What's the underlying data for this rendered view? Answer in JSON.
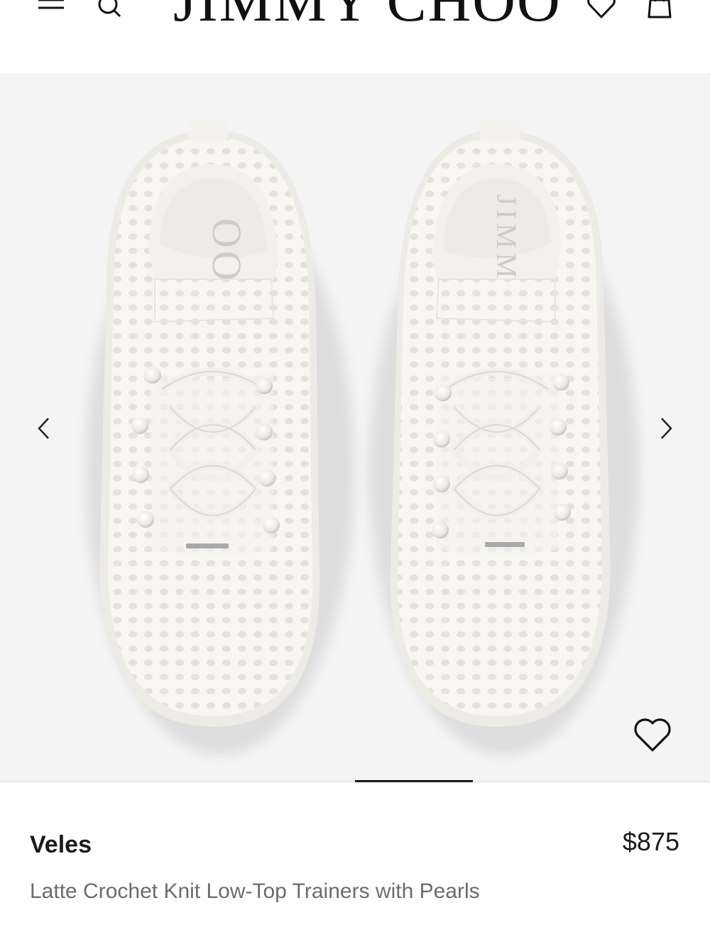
{
  "header": {
    "logo_text": "JIMMY CHOO"
  },
  "product": {
    "name": "Veles",
    "price": "$875",
    "description": "Latte Crochet Knit Low-Top Trainers with Pearls"
  },
  "gallery": {
    "current_slide_fraction": 0.5,
    "background_color": "#f4f4f4"
  },
  "icons": {
    "menu": "hamburger-icon",
    "search": "search-icon",
    "wishlist": "heart-icon",
    "bag": "shopping-bag-icon",
    "prev": "chevron-left-icon",
    "next": "chevron-right-icon"
  }
}
